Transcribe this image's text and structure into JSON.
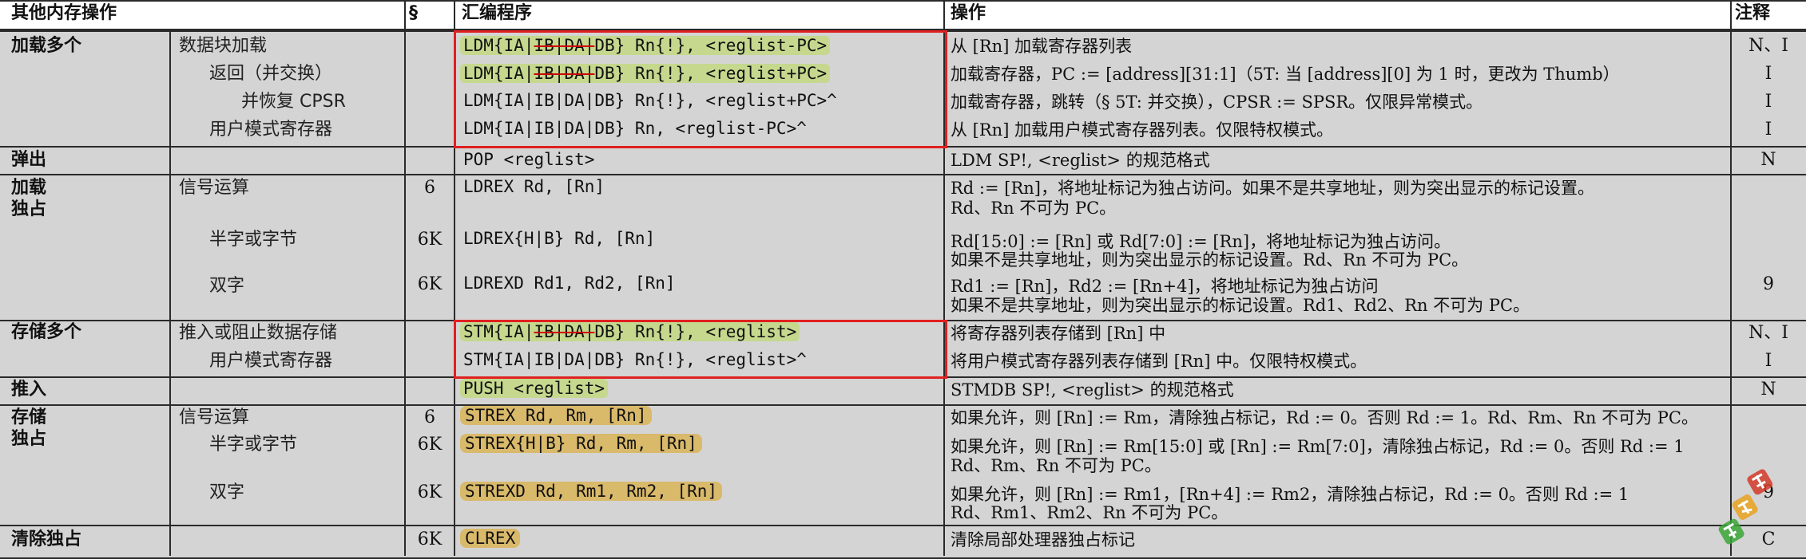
{
  "headers": {
    "col1": "其他内存操作",
    "col2": "§",
    "col3": "汇编程序",
    "col4": "操作",
    "col5": "注释"
  },
  "load_multiple": {
    "group": "加载多个",
    "rows": [
      {
        "sub": "数据块加载",
        "code_prefix": "LDM{IA|",
        "code_strike": "IB|DA|",
        "code_suffix": "DB} Rn{!}, <reglist-PC>",
        "op": "从 [Rn] 加载寄存器列表",
        "note": "N、I"
      },
      {
        "sub": "返回（并交换）",
        "code_prefix": "LDM{IA|",
        "code_strike": "IB|DA|",
        "code_suffix": "DB} Rn{!}, <reglist+PC>",
        "op": "加载寄存器，PC := [address][31:1]（5T: 当 [address][0] 为 1 时，更改为 Thumb）",
        "note": "I"
      },
      {
        "sub": "并恢复 CPSR",
        "code": "LDM{IA|IB|DA|DB} Rn{!}, <reglist+PC>^",
        "op": "加载寄存器，跳转（§ 5T: 并交换），CPSR := SPSR。仅限异常模式。",
        "note": "I"
      },
      {
        "sub": "用户模式寄存器",
        "code": "LDM{IA|IB|DA|DB} Rn, <reglist-PC>^",
        "op": "从 [Rn] 加载用户模式寄存器列表。仅限特权模式。",
        "note": "I"
      }
    ]
  },
  "pop": {
    "group": "弹出",
    "code": "POP <reglist>",
    "op": "LDM SP!, <reglist> 的规范格式",
    "note": "N"
  },
  "load_exclusive": {
    "group_line1": "加载",
    "group_line2": "独占",
    "rows": [
      {
        "sub": "信号运算",
        "sec": "6",
        "code": "LDREX Rd, [Rn]",
        "op1": "Rd := [Rn]，将地址标记为独占访问。如果不是共享地址，则为突出显示的标记设置。",
        "op2": "Rd、Rn 不可为 PC。",
        "note": ""
      },
      {
        "sub": "半字或字节",
        "sec": "6K",
        "code": "LDREX{H|B} Rd, [Rn]",
        "op1": "Rd[15:0] := [Rn] 或 Rd[7:0] := [Rn]，将地址标记为独占访问。",
        "op2": "如果不是共享地址，则为突出显示的标记设置。Rd、Rn 不可为 PC。",
        "note": ""
      },
      {
        "sub": "双字",
        "sec": "6K",
        "code": "LDREXD Rd1, Rd2, [Rn]",
        "op1": "Rd1 := [Rn]，Rd2 := [Rn+4]，将地址标记为独占访问",
        "op2": "如果不是共享地址，则为突出显示的标记设置。Rd1、Rd2、Rn 不可为 PC。",
        "note": "9"
      }
    ]
  },
  "store_multiple": {
    "group": "存储多个",
    "rows": [
      {
        "sub": "推入或阻止数据存储",
        "code_prefix": "STM{IA|",
        "code_strike": "IB|DA|",
        "code_suffix": "DB} Rn{!}, <reglist>",
        "op": "将寄存器列表存储到 [Rn] 中",
        "note": "N、I"
      },
      {
        "sub": "用户模式寄存器",
        "code": "STM{IA|IB|DA|DB} Rn{!}, <reglist>^",
        "op": "将用户模式寄存器列表存储到 [Rn] 中。仅限特权模式。",
        "note": "I"
      }
    ]
  },
  "push": {
    "group": "推入",
    "code": "PUSH <reglist>",
    "op": "STMDB SP!, <reglist> 的规范格式",
    "note": "N"
  },
  "store_exclusive": {
    "group_line1": "存储",
    "group_line2": "独占",
    "rows": [
      {
        "sub": "信号运算",
        "sec": "6",
        "code": "STREX Rd, Rm, [Rn]",
        "op1": "如果允许，则 [Rn] := Rm，清除独占标记，Rd := 0。否则 Rd := 1。Rd、Rm、Rn 不可为 PC。",
        "op2": "",
        "note": ""
      },
      {
        "sub": "半字或字节",
        "sec": "6K",
        "code": "STREX{H|B} Rd, Rm, [Rn]",
        "op1": "如果允许，则 [Rn] := Rm[15:0] 或 [Rn] := Rm[7:0]，清除独占标记，Rd := 0。否则 Rd := 1",
        "op2": "Rd、Rm、Rn 不可为 PC。",
        "note": ""
      },
      {
        "sub": "双字",
        "sec": "6K",
        "code": "STREXD Rd, Rm1, Rm2, [Rn]",
        "op1": "如果允许，则 [Rn] := Rm1，[Rn+4] := Rm2，清除独占标记，Rd := 0。否则 Rd := 1",
        "op2": "Rd、Rm1、Rm2、Rn 不可为 PC。",
        "note": "9"
      }
    ]
  },
  "clrex": {
    "group": "清除独占",
    "sec": "6K",
    "code": "CLREX",
    "op": "清除局部处理器独占标记",
    "note": "C"
  },
  "colors": {
    "background": "#d4d4d4",
    "green_highlight": "#c5d88e",
    "gold_highlight": "#d9b96a",
    "red_box": "#e02020"
  },
  "watermark": {
    "icon": "watermark-logo-icon"
  }
}
